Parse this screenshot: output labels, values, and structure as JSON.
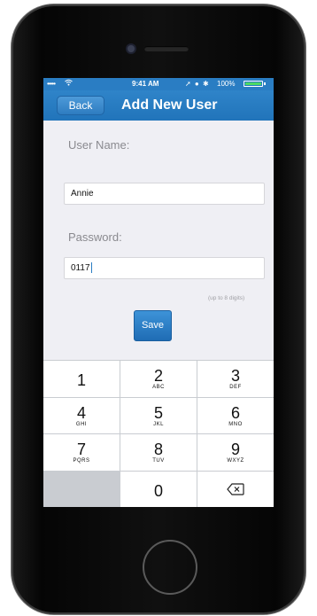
{
  "status_bar": {
    "carrier": "•••••",
    "wifi_icon": "wifi-icon",
    "time": "9:41 AM",
    "icons": "➚ ● ✱",
    "battery": "100%"
  },
  "nav": {
    "back_label": "Back",
    "title": "Add New User"
  },
  "form": {
    "username_label": "User Name:",
    "username_value": "Annie",
    "password_label": "Password:",
    "password_value": "0117",
    "hint": "(up to 8 digits)",
    "save_label": "Save"
  },
  "keypad": {
    "keys": [
      {
        "num": "1",
        "letters": ""
      },
      {
        "num": "2",
        "letters": "ABC"
      },
      {
        "num": "3",
        "letters": "DEF"
      },
      {
        "num": "4",
        "letters": "GHI"
      },
      {
        "num": "5",
        "letters": "JKL"
      },
      {
        "num": "6",
        "letters": "MNO"
      },
      {
        "num": "7",
        "letters": "PQRS"
      },
      {
        "num": "8",
        "letters": "TUV"
      },
      {
        "num": "9",
        "letters": "WXYZ"
      },
      {
        "num": "",
        "letters": ""
      },
      {
        "num": "0",
        "letters": ""
      },
      {
        "num": "",
        "letters": "",
        "icon": "backspace-icon"
      }
    ]
  },
  "colors": {
    "accent": "#2a7dc3",
    "background": "#efeff4",
    "keypad_bg": "#c9ccd1"
  }
}
